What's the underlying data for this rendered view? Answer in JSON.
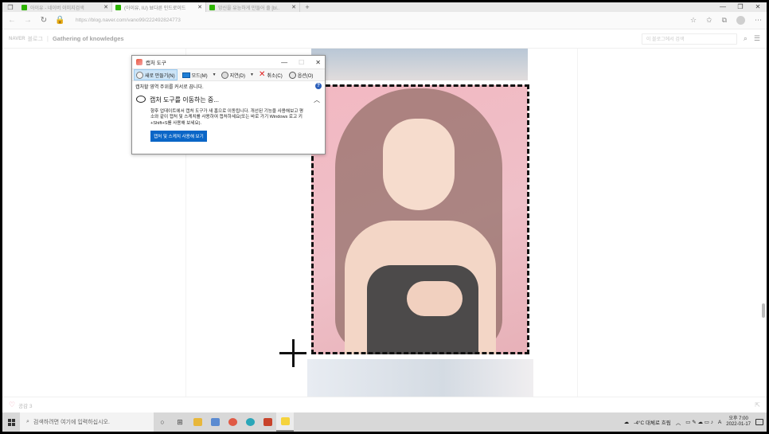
{
  "browser": {
    "tabs": [
      {
        "title": "아이유 - 네이버 이미지검색",
        "favicon_color": "#2db400"
      },
      {
        "title": "(아이유, IU) 뵤다른 인드로이드",
        "favicon_color": "#2db400"
      },
      {
        "title": "망신을 유능하게 만들어 줄 [bl..",
        "favicon_color": "#2db400"
      }
    ],
    "active_tab_index": 1,
    "url": "https://blog.naver.com/vano99/222492824773"
  },
  "blog": {
    "logo": "NAVER",
    "section": "블로그",
    "title": "Gathering of knowledges",
    "search_placeholder": "이 블로그에서 검색",
    "like_label": "공감 3"
  },
  "snipping_tool": {
    "title": "캡처 도구",
    "toolbar": {
      "new": "새로 만들기(N)",
      "mode": "모드(M)",
      "delay": "지연(D)",
      "cancel": "취소(C)",
      "options": "옵션(O)"
    },
    "hint": "캡처할 영역 주위를 커서로 끕니다.",
    "heading": "캡처 도구를 이동하는 중...",
    "body": "향후 업데이트에서 캡처 도구가 새 홈으로 이동됩니다. 개선된 기능을 사용해보고 평소와 같이 캡처 및 스케치를 사용하여 캡처하세요(또는 바로 가기 Windows 로고 키+Shift+S를 사용해 보세요).",
    "link_button": "캡처 및 스케치 사용해 보기"
  },
  "taskbar": {
    "search_placeholder": "검색하려면 여기에 입력하십시오.",
    "weather": "-4°C  대체로 흐림",
    "ime": "A",
    "time": "오후 7:00",
    "date": "2022-01-17"
  }
}
